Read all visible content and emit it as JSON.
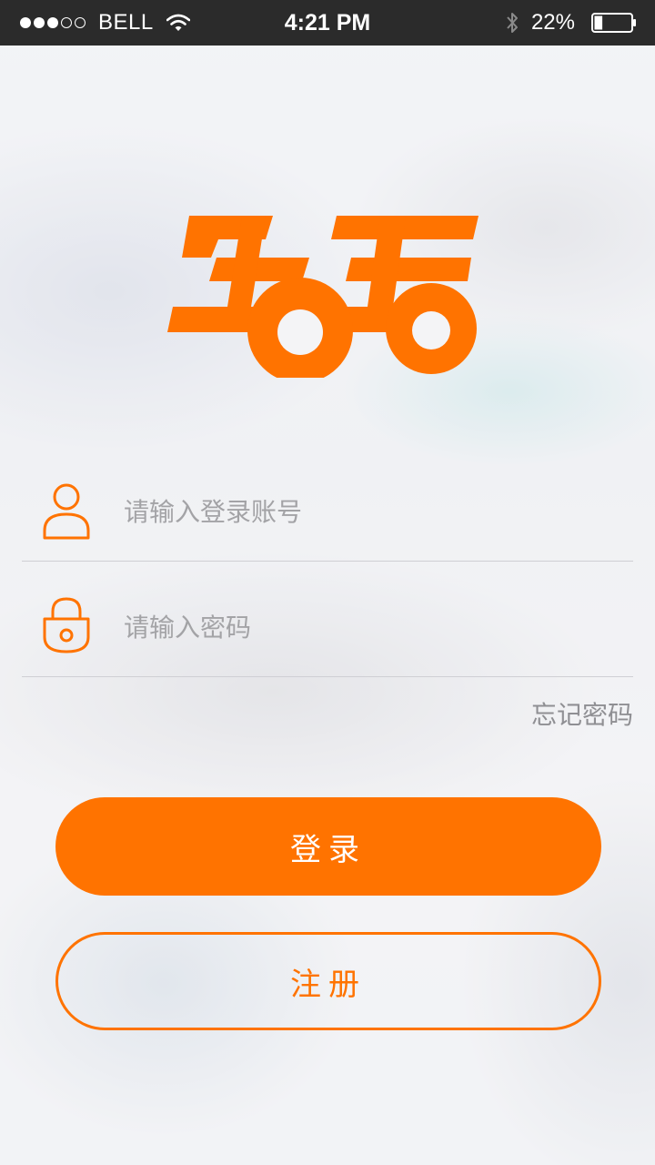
{
  "status_bar": {
    "carrier": "BELL",
    "time": "4:21 PM",
    "battery": "22%",
    "battery_level": 0.22,
    "signal_bars": 3,
    "signal_total": 5,
    "icons": [
      "signal-dots-icon",
      "wifi-icon",
      "bluetooth-icon",
      "battery-icon"
    ]
  },
  "colors": {
    "accent": "#ff7300",
    "status_bar_bg": "#2b2b2b",
    "placeholder": "#a3a3a6",
    "link_gray": "#8f8f93"
  },
  "logo": {
    "icon": "car-logo-icon"
  },
  "form": {
    "username": {
      "icon": "user-icon",
      "placeholder": "请输入登录账号",
      "value": ""
    },
    "password": {
      "icon": "lock-icon",
      "placeholder": "请输入密码",
      "value": ""
    },
    "forgot_label": "忘记密码"
  },
  "actions": {
    "login_label": "登录",
    "register_label": "注册"
  }
}
